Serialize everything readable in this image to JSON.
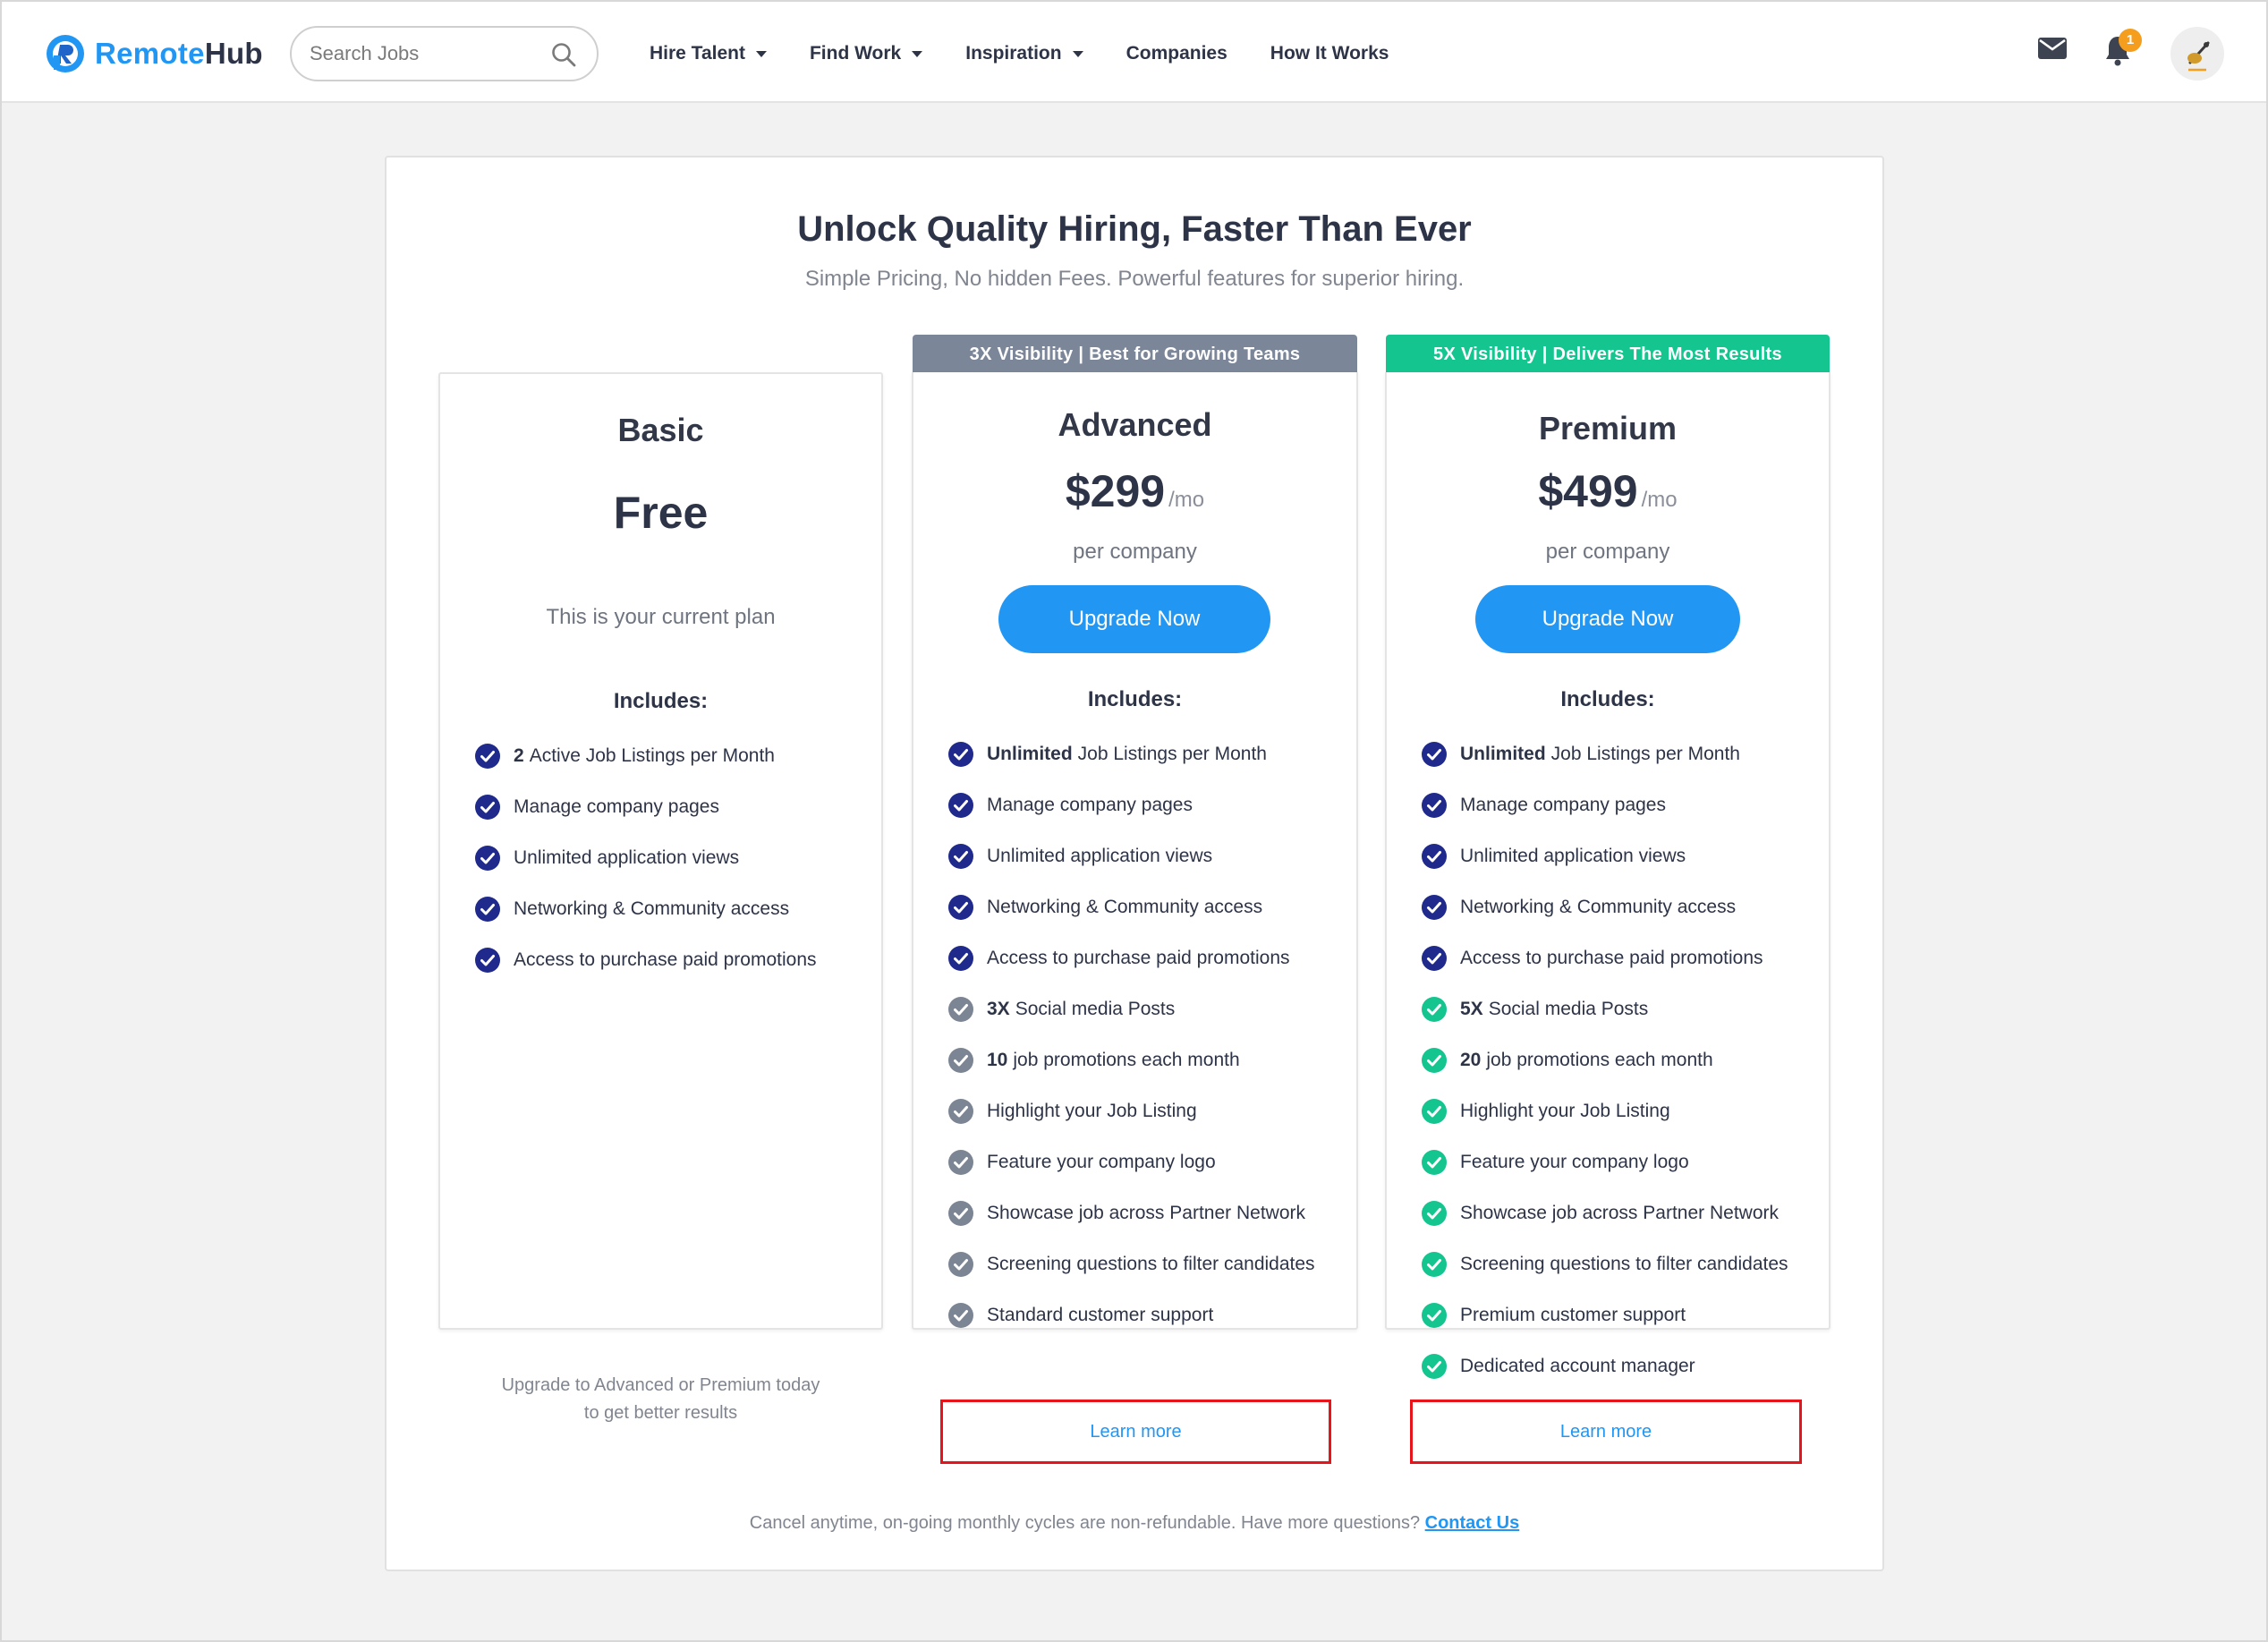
{
  "header": {
    "logo_part1": "Remote",
    "logo_part2": "Hub",
    "search_placeholder": "Search Jobs",
    "nav": [
      {
        "label": "Hire Talent",
        "dropdown": true
      },
      {
        "label": "Find Work",
        "dropdown": true
      },
      {
        "label": "Inspiration",
        "dropdown": true
      },
      {
        "label": "Companies",
        "dropdown": false
      },
      {
        "label": "How It Works",
        "dropdown": false
      }
    ],
    "notification_count": "1",
    "icons": [
      "mail-icon",
      "bell-icon",
      "avatar"
    ]
  },
  "pricing": {
    "title": "Unlock Quality Hiring, Faster Than Ever",
    "subtitle": "Simple Pricing, No hidden Fees. Powerful features for superior hiring.",
    "includes_label": "Includes:",
    "footnote_text": "Cancel anytime, on-going monthly cycles are non-refundable.  Have more questions?",
    "footnote_link": "Contact Us"
  },
  "plans": {
    "basic": {
      "name": "Basic",
      "price": "Free",
      "current_label": "This is your current plan",
      "features": [
        {
          "bold": "2",
          "text": "Active Job Listings per Month"
        },
        {
          "bold": "",
          "text": "Manage company pages"
        },
        {
          "bold": "",
          "text": "Unlimited application views"
        },
        {
          "bold": "",
          "text": "Networking & Community access"
        },
        {
          "bold": "",
          "text": "Access to purchase paid promotions"
        }
      ],
      "footer_line1": "Upgrade to Advanced or Premium today",
      "footer_line2": "to get better results"
    },
    "advanced": {
      "banner": "3X Visibility | Best for Growing Teams",
      "name": "Advanced",
      "price": "$299",
      "per": "/mo",
      "unit": "per company",
      "button": "Upgrade Now",
      "features": [
        {
          "bold": "Unlimited",
          "text": "Job Listings per Month",
          "tier": "core"
        },
        {
          "bold": "",
          "text": "Manage company pages",
          "tier": "core"
        },
        {
          "bold": "",
          "text": "Unlimited application views",
          "tier": "core"
        },
        {
          "bold": "",
          "text": "Networking & Community access",
          "tier": "core"
        },
        {
          "bold": "",
          "text": "Access to purchase paid promotions",
          "tier": "core"
        },
        {
          "bold": "3X",
          "text": "Social media Posts",
          "tier": "extra"
        },
        {
          "bold": "10",
          "text": "job promotions each month",
          "tier": "extra"
        },
        {
          "bold": "",
          "text": "Highlight your Job Listing",
          "tier": "extra"
        },
        {
          "bold": "",
          "text": "Feature your company logo",
          "tier": "extra"
        },
        {
          "bold": "",
          "text": "Showcase job across Partner Network",
          "tier": "extra"
        },
        {
          "bold": "",
          "text": "Screening questions to filter candidates",
          "tier": "extra"
        },
        {
          "bold": "",
          "text": "Standard customer support",
          "tier": "extra"
        }
      ],
      "learn_more": "Learn more"
    },
    "premium": {
      "banner": "5X Visibility | Delivers The Most Results",
      "name": "Premium",
      "price": "$499",
      "per": "/mo",
      "unit": "per company",
      "button": "Upgrade Now",
      "features": [
        {
          "bold": "Unlimited",
          "text": "Job Listings per Month",
          "tier": "core"
        },
        {
          "bold": "",
          "text": "Manage company pages",
          "tier": "core"
        },
        {
          "bold": "",
          "text": "Unlimited application views",
          "tier": "core"
        },
        {
          "bold": "",
          "text": "Networking & Community access",
          "tier": "core"
        },
        {
          "bold": "",
          "text": "Access to purchase paid promotions",
          "tier": "core"
        },
        {
          "bold": "5X",
          "text": "Social media Posts",
          "tier": "premium"
        },
        {
          "bold": "20",
          "text": "job promotions each month",
          "tier": "premium"
        },
        {
          "bold": "",
          "text": "Highlight your Job Listing",
          "tier": "premium"
        },
        {
          "bold": "",
          "text": "Feature your company logo",
          "tier": "premium"
        },
        {
          "bold": "",
          "text": "Showcase job across Partner Network",
          "tier": "premium"
        },
        {
          "bold": "",
          "text": "Screening questions to filter candidates",
          "tier": "premium"
        },
        {
          "bold": "",
          "text": "Premium customer support",
          "tier": "premium"
        },
        {
          "bold": "",
          "text": "Dedicated account manager",
          "tier": "premium"
        }
      ],
      "learn_more": "Learn more"
    }
  },
  "colors": {
    "brand": "#2196f3",
    "core_check": "#1f2a8c",
    "extra_check": "#7c8593",
    "premium_check": "#14c58f",
    "advanced_banner": "#7c8699",
    "premium_banner": "#14c58f",
    "highlight_box": "#e8141c",
    "badge": "#f59d1c"
  }
}
